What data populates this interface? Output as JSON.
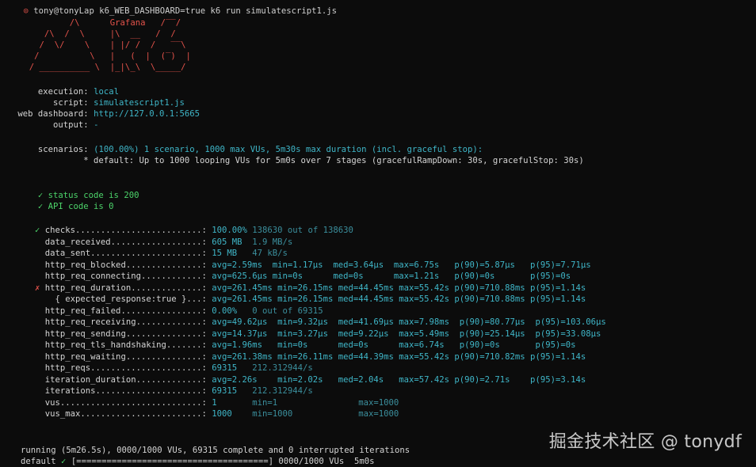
{
  "prompt": {
    "user": "tony@tonyLap",
    "command": "k6_WEB_DASHBOARD=true k6 run simulatescript1.js"
  },
  "logo": {
    "lines": [
      "          /\\      Grafana   /‾‾/",
      "     /\\  /  \\     |\\  __   /  /",
      "    /  \\/    \\    | |/ /  /   ‾‾\\",
      "   /          \\   |   (  |  (‾)  |",
      "  / __________ \\  |_|\\_\\  \\_____/"
    ]
  },
  "config": [
    {
      "label": "     execution:",
      "value": "local"
    },
    {
      "label": "        script:",
      "value": "simulatescript1.js"
    },
    {
      "label": " web dashboard:",
      "value": "http://127.0.0.1:5665"
    },
    {
      "label": "        output:",
      "value": "-"
    }
  ],
  "scenarios": {
    "label": "     scenarios:",
    "value": "(100.00%) 1 scenario, 1000 max VUs, 5m30s max duration (incl. graceful stop):",
    "detail": "              * default: Up to 1000 looping VUs for 5m0s over 7 stages (gracefulRampDown: 30s, gracefulStop: 30s)"
  },
  "checks": [
    "     ✓ status code is 200",
    "     ✓ API code is 0"
  ],
  "metrics": [
    {
      "mark": "✓",
      "mark_color": "ok",
      "name": "checks.........................:",
      "cols": [
        [
          "100.00%",
          "val"
        ],
        [
          " 138630 out of 138630",
          "dim"
        ]
      ]
    },
    {
      "mark": " ",
      "mark_color": "ok",
      "name": "data_received..................:",
      "cols": [
        [
          "605 MB",
          "val"
        ],
        [
          "  1.9 MB/s",
          "dim"
        ]
      ]
    },
    {
      "mark": " ",
      "mark_color": "ok",
      "name": "data_sent......................:",
      "cols": [
        [
          "15 MB",
          "val"
        ],
        [
          "   47 kB/s",
          "dim"
        ]
      ]
    },
    {
      "mark": " ",
      "mark_color": "ok",
      "name": "http_req_blocked...............:",
      "cols": [
        [
          "avg=2.59ms  min=1.17µs  med=3.64µs  max=6.75s   p(90)=5.87µs   p(95)=7.71µs",
          "val"
        ]
      ]
    },
    {
      "mark": " ",
      "mark_color": "ok",
      "name": "http_req_connecting............:",
      "cols": [
        [
          "avg=625.6µs min=0s      med=0s      max=1.21s   p(90)=0s       p(95)=0s",
          "val"
        ]
      ]
    },
    {
      "mark": "✗",
      "mark_color": "bad",
      "name": "http_req_duration..............:",
      "cols": [
        [
          "avg=261.45ms min=26.15ms med=44.45ms max=55.42s p(90)=710.88ms p(95)=1.14s",
          "val"
        ]
      ]
    },
    {
      "mark": " ",
      "mark_color": "ok",
      "name": "  { expected_response:true }...:",
      "cols": [
        [
          "avg=261.45ms min=26.15ms med=44.45ms max=55.42s p(90)=710.88ms p(95)=1.14s",
          "val"
        ]
      ]
    },
    {
      "mark": " ",
      "mark_color": "ok",
      "name": "http_req_failed................:",
      "cols": [
        [
          "0.00%",
          "val"
        ],
        [
          "   0 out of 69315",
          "dim"
        ]
      ]
    },
    {
      "mark": " ",
      "mark_color": "ok",
      "name": "http_req_receiving.............:",
      "cols": [
        [
          "avg=49.62µs  min=9.32µs  med=41.69µs max=7.98ms  p(90)=80.77µs  p(95)=103.06µs",
          "val"
        ]
      ]
    },
    {
      "mark": " ",
      "mark_color": "ok",
      "name": "http_req_sending...............:",
      "cols": [
        [
          "avg=14.37µs  min=3.27µs  med=9.22µs  max=5.49ms  p(90)=25.14µs  p(95)=33.08µs",
          "val"
        ]
      ]
    },
    {
      "mark": " ",
      "mark_color": "ok",
      "name": "http_req_tls_handshaking.......:",
      "cols": [
        [
          "avg=1.96ms   min=0s      med=0s      max=6.74s   p(90)=0s       p(95)=0s",
          "val"
        ]
      ]
    },
    {
      "mark": " ",
      "mark_color": "ok",
      "name": "http_req_waiting...............:",
      "cols": [
        [
          "avg=261.38ms min=26.11ms med=44.39ms max=55.42s p(90)=710.82ms p(95)=1.14s",
          "val"
        ]
      ]
    },
    {
      "mark": " ",
      "mark_color": "ok",
      "name": "http_reqs......................:",
      "cols": [
        [
          "69315",
          "val"
        ],
        [
          "   212.312944/s",
          "dim"
        ]
      ]
    },
    {
      "mark": " ",
      "mark_color": "ok",
      "name": "iteration_duration.............:",
      "cols": [
        [
          "avg=2.26s    min=2.02s   med=2.04s   max=57.42s p(90)=2.71s    p(95)=3.14s",
          "val"
        ]
      ]
    },
    {
      "mark": " ",
      "mark_color": "ok",
      "name": "iterations.....................:",
      "cols": [
        [
          "69315",
          "val"
        ],
        [
          "   212.312944/s",
          "dim"
        ]
      ]
    },
    {
      "mark": " ",
      "mark_color": "ok",
      "name": "vus............................:",
      "cols": [
        [
          "1",
          "val"
        ],
        [
          "       min=1                max=1000",
          "dim"
        ]
      ]
    },
    {
      "mark": " ",
      "mark_color": "ok",
      "name": "vus_max........................:",
      "cols": [
        [
          "1000",
          "val"
        ],
        [
          "    min=1000             max=1000",
          "dim"
        ]
      ]
    }
  ],
  "footer": {
    "running": "running (5m26.5s), 0000/1000 VUs, 69315 complete and 0 interrupted iterations",
    "default_label": "default",
    "default_check": "✓",
    "progress": "[======================================] 0000/1000 VUs  5m0s"
  },
  "watermark": "掘金技术社区 @ tonydf",
  "colors": {
    "background": "#0c0c0c",
    "value": "#3fb6c8",
    "value_dim": "#3b8f9d",
    "ok": "#4cd46a",
    "error": "#e5534b",
    "logo": "#e5534b"
  }
}
